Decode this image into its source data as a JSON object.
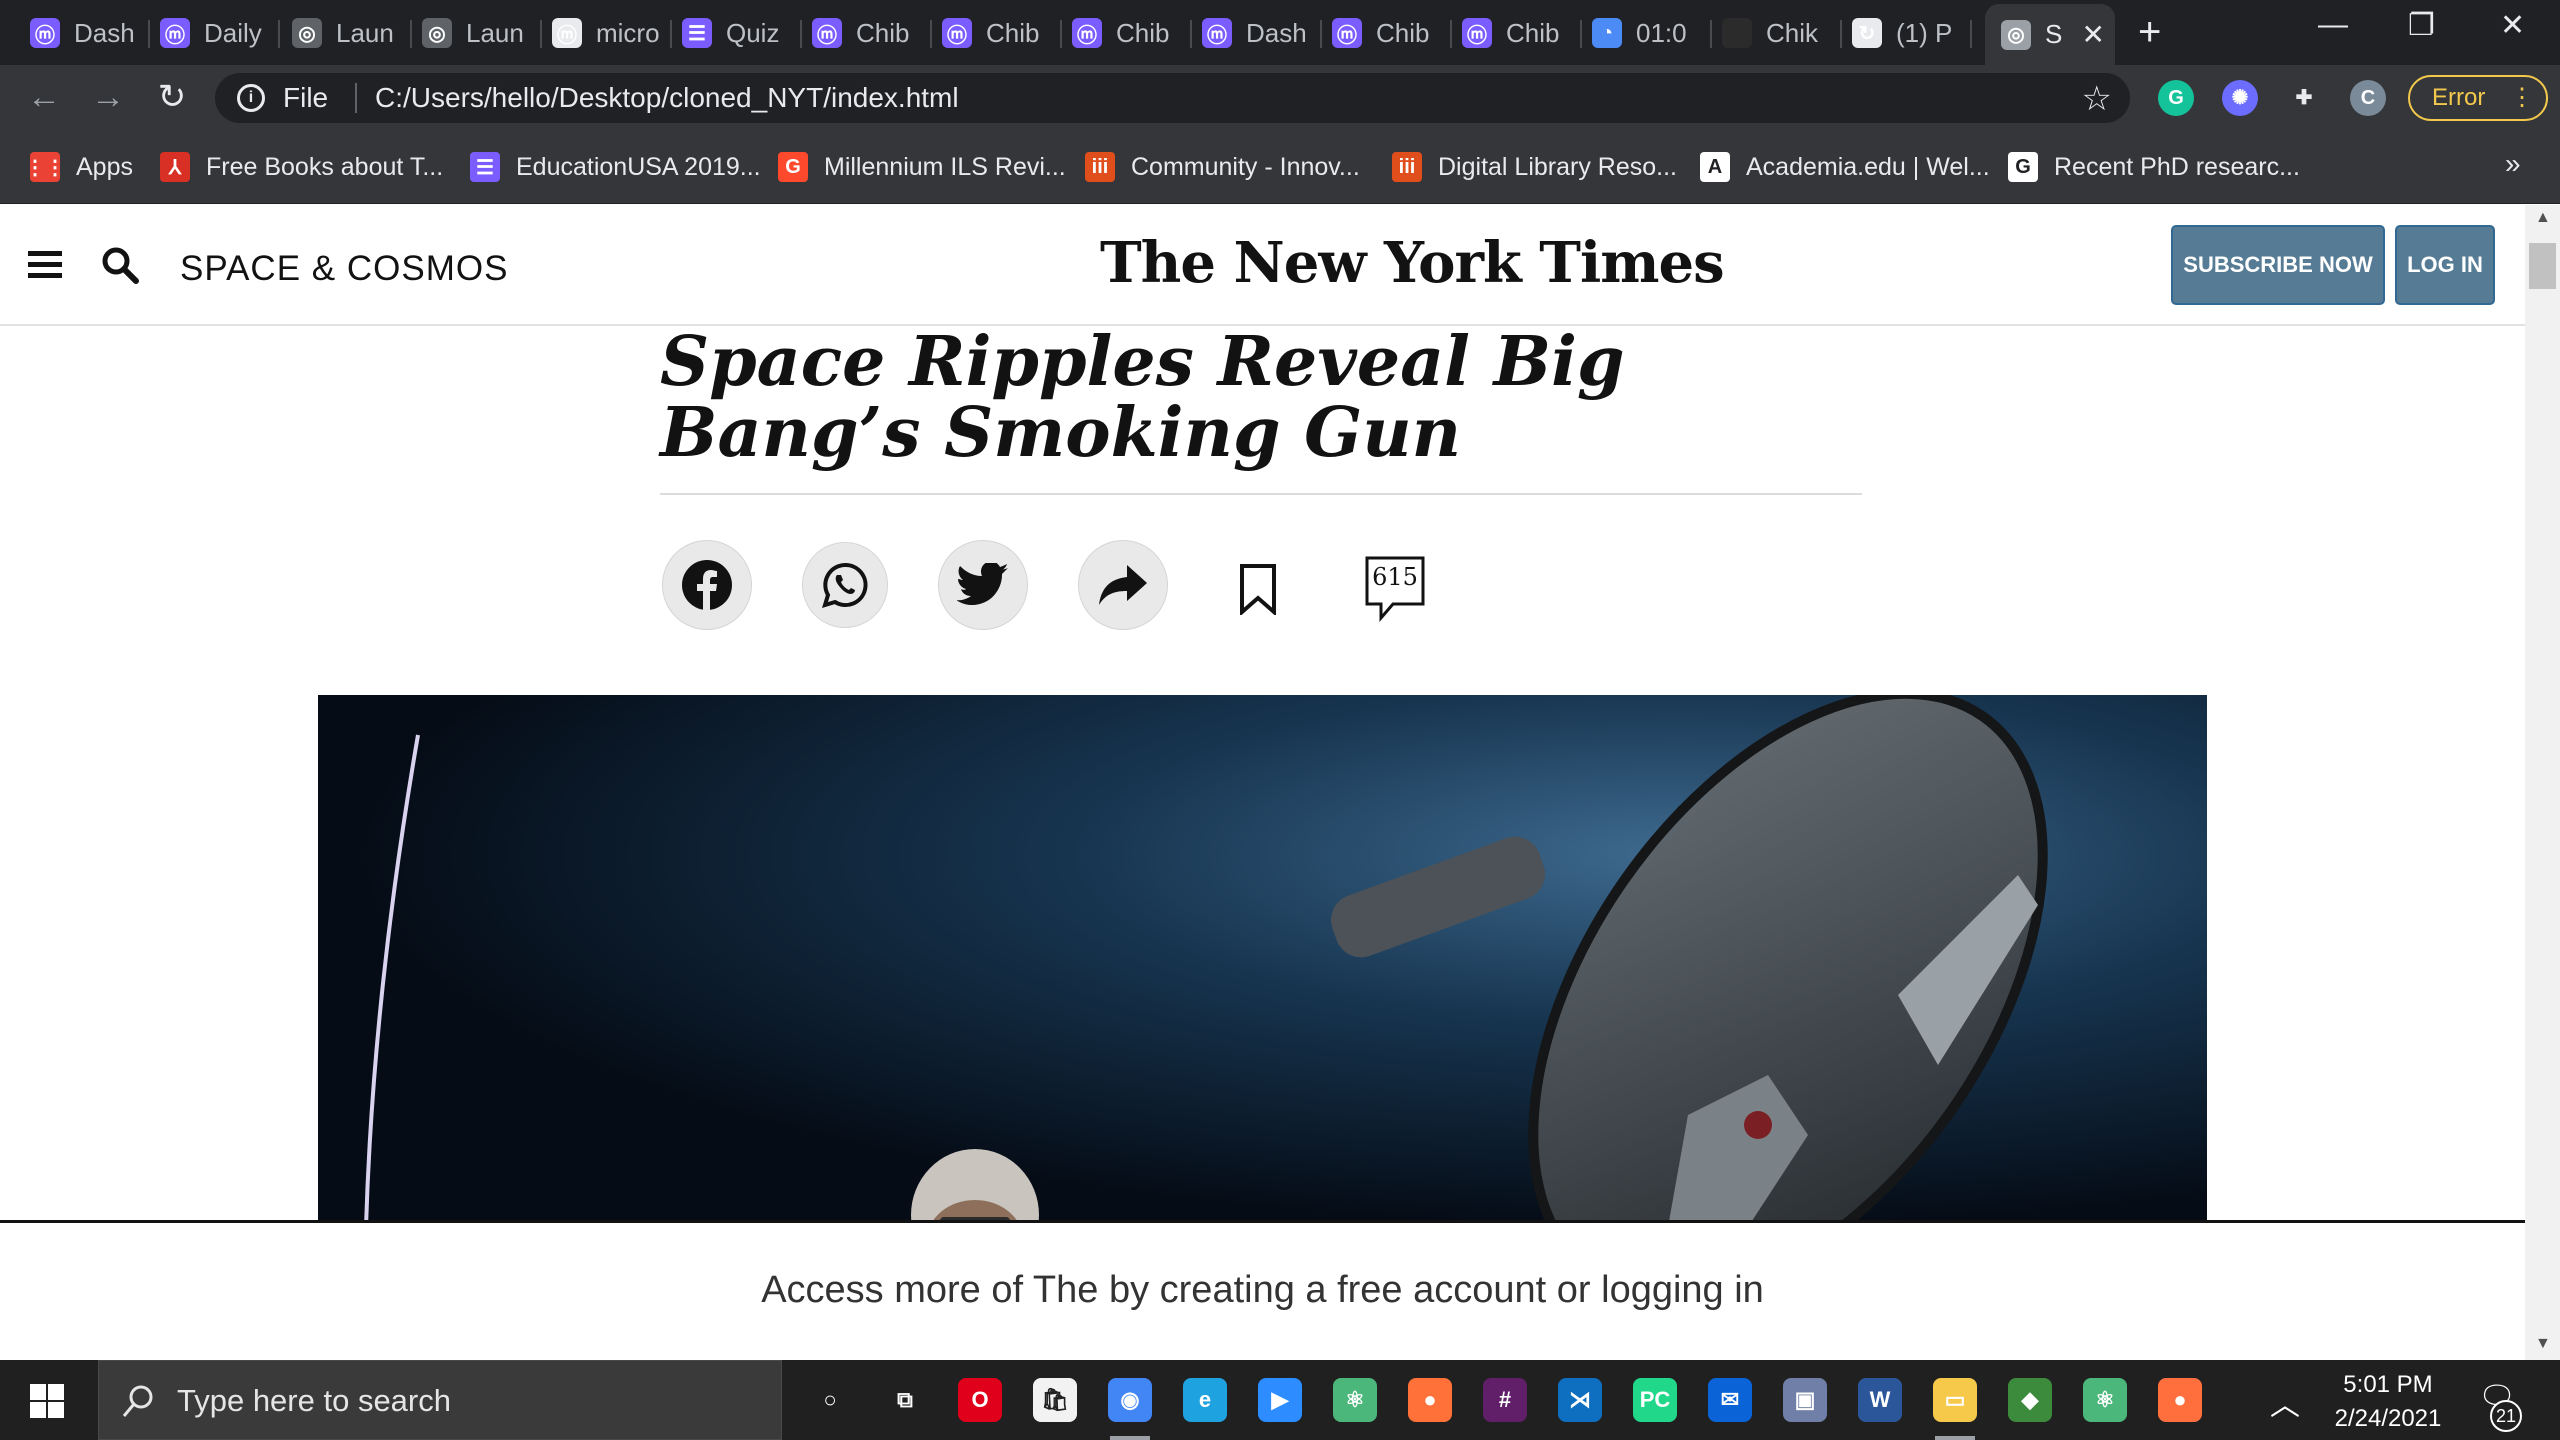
{
  "browser": {
    "tabs": [
      {
        "label": "Dash",
        "icon": "monday-icon",
        "color": "#7b5cff"
      },
      {
        "label": "Daily",
        "icon": "monday-icon",
        "color": "#7b5cff"
      },
      {
        "label": "Laun",
        "icon": "globe-icon",
        "color": "#5f6368"
      },
      {
        "label": "Laun",
        "icon": "globe-icon",
        "color": "#5f6368"
      },
      {
        "label": "micro",
        "icon": "monday-icon",
        "color": "#e8eaed"
      },
      {
        "label": "Quiz",
        "icon": "list-icon",
        "color": "#7b5cff"
      },
      {
        "label": "Chib",
        "icon": "monday-icon",
        "color": "#7b5cff"
      },
      {
        "label": "Chib",
        "icon": "monday-icon",
        "color": "#7b5cff"
      },
      {
        "label": "Chib",
        "icon": "monday-icon",
        "color": "#7b5cff"
      },
      {
        "label": "Dash",
        "icon": "monday-icon",
        "color": "#7b5cff"
      },
      {
        "label": "Chib",
        "icon": "monday-icon",
        "color": "#7b5cff"
      },
      {
        "label": "Chib",
        "icon": "monday-icon",
        "color": "#7b5cff"
      },
      {
        "label": "01:0",
        "icon": "clock-icon",
        "color": "#4c8bf5"
      },
      {
        "label": "Chik",
        "icon": "github-icon",
        "color": "#2b2b2b"
      },
      {
        "label": "(1) P",
        "icon": "refresh-icon",
        "color": "#e8eaed"
      },
      {
        "label": "S",
        "icon": "globe-icon",
        "color": "#9aa0a6",
        "active": true
      }
    ],
    "new_tab_symbol": "+",
    "window_controls": {
      "minimize": "—",
      "restore": "❐",
      "close": "✕"
    },
    "address": {
      "scheme_label": "File",
      "url": "C:/Users/hello/Desktop/cloned_NYT/index.html"
    },
    "extensions": [
      {
        "name": "grammarly-icon",
        "letter": "G",
        "color": "#15c39a"
      },
      {
        "name": "extension-star-icon",
        "letter": "✺",
        "color": "#6c6cff"
      },
      {
        "name": "puzzle-icon",
        "letter": "✚",
        "color": "#35363a"
      },
      {
        "name": "profile-avatar",
        "letter": "C",
        "color": "#7a8a99"
      }
    ],
    "error_label": "Error",
    "bookmarks": [
      {
        "label": "Apps",
        "icon": "apps-grid-icon",
        "color": "#ea4335"
      },
      {
        "label": "Free Books about T...",
        "icon": "pdf-icon",
        "color": "#d93025"
      },
      {
        "label": "EducationUSA 2019...",
        "icon": "list-icon",
        "color": "#7b5cff"
      },
      {
        "label": "Millennium ILS Revi...",
        "icon": "g2-icon",
        "color": "#ff492c"
      },
      {
        "label": "Community - Innov...",
        "icon": "iii-icon",
        "color": "#e04e1b"
      },
      {
        "label": "Digital Library Reso...",
        "icon": "iii-icon",
        "color": "#e04e1b"
      },
      {
        "label": "Academia.edu | Wel...",
        "icon": "academia-icon",
        "color": "#ffffff"
      },
      {
        "label": "Recent PhD researc...",
        "icon": "google-icon",
        "color": "#ffffff"
      }
    ],
    "bookmarks_more": "»"
  },
  "page": {
    "section": "SPACE & COSMOS",
    "masthead": "The New York Times",
    "subscribe_label": "SUBSCRIBE NOW",
    "login_label": "LOG IN",
    "headline": "Space Ripples Reveal Big Bang’s Smoking Gun",
    "comment_count": "615",
    "registration_text": "Access more of The by creating a free account or logging in"
  },
  "taskbar": {
    "search_placeholder": "Type here to search",
    "apps": [
      {
        "name": "cortana-icon",
        "color": "transparent"
      },
      {
        "name": "task-view-icon",
        "color": "transparent"
      },
      {
        "name": "opera-icon",
        "color": "#e0001b"
      },
      {
        "name": "store-icon",
        "color": "#f2f2f2"
      },
      {
        "name": "chrome-icon",
        "color": "#4285f4"
      },
      {
        "name": "edge-icon",
        "color": "#1fa2e0"
      },
      {
        "name": "zoom-icon",
        "color": "#2d8cff"
      },
      {
        "name": "atom-icon",
        "color": "#4bb77a"
      },
      {
        "name": "firefox-icon",
        "color": "#ff7139"
      },
      {
        "name": "slack-icon",
        "color": "#611f69"
      },
      {
        "name": "vscode-icon",
        "color": "#0e6fc0"
      },
      {
        "name": "pycharm-icon",
        "color": "#21d789"
      },
      {
        "name": "mail-icon",
        "color": "#0a64d8"
      },
      {
        "name": "virtualbox-icon",
        "color": "#6f7fa7"
      },
      {
        "name": "word-icon",
        "color": "#2b579a"
      },
      {
        "name": "file-explorer-icon",
        "color": "#f6c94a"
      },
      {
        "name": "git-icon",
        "color": "#3c8a3c"
      },
      {
        "name": "atom-alt-icon",
        "color": "#4bb77a"
      },
      {
        "name": "drop-icon",
        "color": "#ff6f3d"
      }
    ],
    "time": "5:01 PM",
    "date": "2/24/2021",
    "notification_count": "21"
  }
}
